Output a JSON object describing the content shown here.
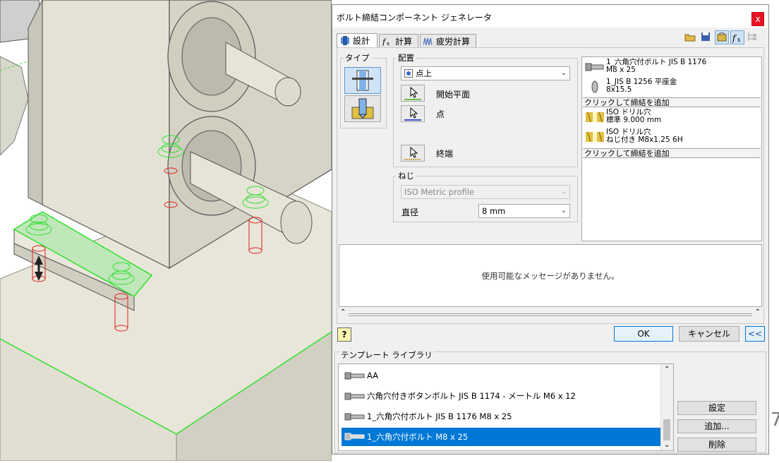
{
  "dialog": {
    "title": "ボルト締結コンポーネント ジェネレータ",
    "close_label": "x",
    "tabs": [
      {
        "label": "設計",
        "icon": "design-icon"
      },
      {
        "label": "計算",
        "icon": "fx-calc-icon"
      },
      {
        "label": "疲労計算",
        "icon": "fatigue-icon"
      }
    ],
    "toolbar_icons": [
      "open-folder-icon",
      "save-icon",
      "options-icon",
      "fx-icon",
      "tree-icon"
    ]
  },
  "type_group": {
    "label": "タイプ",
    "options": [
      {
        "name": "through-hole-type",
        "selected": true
      },
      {
        "name": "blind-hole-type",
        "selected": false
      }
    ]
  },
  "placement": {
    "label": "配置",
    "combo_value": "点上",
    "start_plane_label": "開始平面",
    "point_label": "点",
    "end_label": "終端"
  },
  "thread": {
    "label": "ねじ",
    "profile_value": "ISO Metric profile",
    "diameter_label": "直径",
    "diameter_value": "8 mm"
  },
  "components": {
    "rows": [
      {
        "line1": "1_六角穴付ボルト JIS B 1176",
        "line2": "M8 x 25",
        "icon": "bolt-icon"
      },
      {
        "line1": "1_JIS B 1256 平座金",
        "line2": "8x15.5",
        "icon": "washer-icon"
      }
    ],
    "click_add_1": "クリックして締結を追加",
    "holes": [
      {
        "line1": "ISO ドリル穴",
        "line2": "標準 9.000 mm",
        "icon": "drill-hole-icon"
      },
      {
        "line1": "ISO ドリル穴",
        "line2": "ねじ付き M8x1.25 6H",
        "icon": "tapped-hole-icon"
      }
    ],
    "click_add_2": "クリックして締結を追加"
  },
  "messages": {
    "text": "使用可能なメッセージがありません。"
  },
  "buttons": {
    "ok": "OK",
    "cancel": "キャンセル",
    "collapse": "<<",
    "help": "?"
  },
  "library": {
    "label": "テンプレート ライブラリ",
    "items": [
      {
        "label": "AA",
        "selected": false
      },
      {
        "label": "六角穴付きボタンボルト JIS B 1174 - メートル M6 x 12",
        "selected": false
      },
      {
        "label": "1_六角穴付ボルト JIS B 1176 M8 x 25",
        "selected": false
      },
      {
        "label": "1_六角穴付ボルト M8 x 25",
        "selected": true
      }
    ],
    "btn_settings": "設定",
    "btn_add": "追加...",
    "btn_delete": "削除"
  },
  "colors": {
    "selection": "#0078d7",
    "model_body": "#e8e6d8",
    "highlight_green": "#32e032",
    "hole_red": "#e02020"
  },
  "edge_text": "7"
}
